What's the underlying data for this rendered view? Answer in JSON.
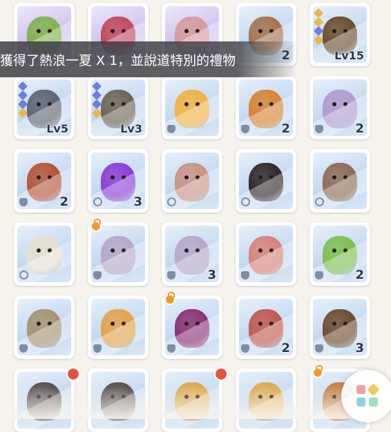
{
  "toast": {
    "message": "獲得了熱浪一夏 X 1，並說道特別的禮物"
  },
  "colors": {
    "count_text": "#2a3550",
    "lock": "#f29a2e",
    "alert": "#e5533d",
    "rarity_blue": "#6a7fe0",
    "rarity_gold": "#f0b640"
  },
  "cards": [
    {
      "creature": "green-goblin-figure",
      "body": "#7fb24a",
      "count": "",
      "level": "",
      "rarity": [],
      "bg": "purple",
      "type": "",
      "lock": false,
      "alert": false
    },
    {
      "creature": "red-caterpillar",
      "body": "#c2485a",
      "count": "",
      "level": "",
      "rarity": [],
      "bg": "purple",
      "type": "",
      "lock": false,
      "alert": false
    },
    {
      "creature": "pink-armored-beast",
      "body": "#d79a9a",
      "count": "",
      "level": "",
      "rarity": [],
      "bg": "purple",
      "type": "",
      "lock": false,
      "alert": false
    },
    {
      "creature": "orc-warrior",
      "body": "#a5704a",
      "count": "2",
      "level": "",
      "rarity": [],
      "bg": "blue",
      "type": "",
      "lock": false,
      "alert": false
    },
    {
      "creature": "brown-spider",
      "body": "#6b4a2b",
      "count": "",
      "level": "Lv15",
      "rarity": [
        "gold",
        "gold",
        "blue",
        "gold"
      ],
      "bg": "blue",
      "type": "",
      "lock": false,
      "alert": false
    },
    {
      "creature": "grey-bear",
      "body": "#5c6270",
      "count": "",
      "level": "Lv5",
      "rarity": [
        "blue",
        "blue",
        "blue",
        "gold"
      ],
      "bg": "blue",
      "type": "",
      "lock": false,
      "alert": false
    },
    {
      "creature": "caged-figure",
      "body": "#6d6252",
      "count": "",
      "level": "Lv3",
      "rarity": [
        "blue",
        "blue",
        "blue",
        "gold"
      ],
      "bg": "blue",
      "type": "",
      "lock": false,
      "alert": false
    },
    {
      "creature": "fox-girl",
      "body": "#f2b240",
      "count": "",
      "level": "",
      "rarity": [],
      "bg": "blue",
      "type": "cat",
      "lock": false,
      "alert": false
    },
    {
      "creature": "tiger-man",
      "body": "#d7832f",
      "count": "2",
      "level": "",
      "rarity": [],
      "bg": "blue",
      "type": "cat",
      "lock": false,
      "alert": false
    },
    {
      "creature": "purple-mouse",
      "body": "#b19ad0",
      "count": "2",
      "level": "",
      "rarity": [],
      "bg": "blue",
      "type": "shield",
      "lock": false,
      "alert": false
    },
    {
      "creature": "tree-ent",
      "body": "#b55236",
      "count": "2",
      "level": "",
      "rarity": [],
      "bg": "blue",
      "type": "shield",
      "lock": false,
      "alert": false
    },
    {
      "creature": "purple-flame",
      "body": "#8a3bd6",
      "count": "3",
      "level": "",
      "rarity": [],
      "bg": "blue",
      "type": "circle",
      "lock": false,
      "alert": false
    },
    {
      "creature": "rock-golem",
      "body": "#c99283",
      "count": "",
      "level": "",
      "rarity": [],
      "bg": "blue",
      "type": "circle",
      "lock": false,
      "alert": false
    },
    {
      "creature": "black-spider",
      "body": "#2e2426",
      "count": "",
      "level": "",
      "rarity": [],
      "bg": "blue",
      "type": "circle",
      "lock": false,
      "alert": false
    },
    {
      "creature": "raccoon",
      "body": "#8c6a52",
      "count": "",
      "level": "",
      "rarity": [],
      "bg": "blue",
      "type": "circle",
      "lock": false,
      "alert": false
    },
    {
      "creature": "skeleton",
      "body": "#e6dfcf",
      "count": "",
      "level": "",
      "rarity": [],
      "bg": "blue",
      "type": "circle",
      "lock": false,
      "alert": false
    },
    {
      "creature": "marionette-a",
      "body": "#b7a6c8",
      "count": "",
      "level": "",
      "rarity": [],
      "bg": "blue",
      "type": "bell",
      "lock": true,
      "alert": false
    },
    {
      "creature": "marionette-b",
      "body": "#b7a6c8",
      "count": "3",
      "level": "",
      "rarity": [],
      "bg": "blue",
      "type": "bell",
      "lock": false,
      "alert": false
    },
    {
      "creature": "dancer-girl",
      "body": "#d9807a",
      "count": "",
      "level": "",
      "rarity": [],
      "bg": "blue",
      "type": "bell",
      "lock": false,
      "alert": false
    },
    {
      "creature": "green-fly",
      "body": "#7cc04c",
      "count": "2",
      "level": "",
      "rarity": [],
      "bg": "blue",
      "type": "shirt",
      "lock": false,
      "alert": false
    },
    {
      "creature": "horned-helmet",
      "body": "#a59270",
      "count": "",
      "level": "",
      "rarity": [],
      "bg": "blue",
      "type": "shirt",
      "lock": false,
      "alert": false
    },
    {
      "creature": "dodo-bird",
      "body": "#e6a14a",
      "count": "",
      "level": "",
      "rarity": [],
      "bg": "blue",
      "type": "shirt",
      "lock": false,
      "alert": false
    },
    {
      "creature": "tentacle-pot",
      "body": "#8a2f73",
      "count": "",
      "level": "",
      "rarity": [],
      "bg": "blue",
      "type": "shield",
      "lock": true,
      "alert": false
    },
    {
      "creature": "mummy-warrior",
      "body": "#c1564d",
      "count": "2",
      "level": "",
      "rarity": [],
      "bg": "blue",
      "type": "shield",
      "lock": false,
      "alert": false
    },
    {
      "creature": "brown-spider-2",
      "body": "#6b4a2b",
      "count": "3",
      "level": "",
      "rarity": [],
      "bg": "blue",
      "type": "shield",
      "lock": false,
      "alert": false
    },
    {
      "creature": "viking-skull-a",
      "body": "#574a4a",
      "count": "",
      "level": "",
      "rarity": [],
      "bg": "blue",
      "type": "",
      "lock": false,
      "alert": true
    },
    {
      "creature": "viking-skull-b",
      "body": "#574a4a",
      "count": "",
      "level": "",
      "rarity": [],
      "bg": "blue",
      "type": "",
      "lock": false,
      "alert": false
    },
    {
      "creature": "spiky-hair-a",
      "body": "#e0a84a",
      "count": "",
      "level": "",
      "rarity": [],
      "bg": "blue",
      "type": "",
      "lock": false,
      "alert": true
    },
    {
      "creature": "spiky-hair-b",
      "body": "#e0a84a",
      "count": "",
      "level": "",
      "rarity": [],
      "bg": "blue",
      "type": "",
      "lock": false,
      "alert": false
    },
    {
      "creature": "scroll-creature",
      "body": "#c97b3a",
      "count": "",
      "level": "",
      "rarity": [],
      "bg": "blue",
      "type": "",
      "lock": true,
      "alert": false
    }
  ]
}
